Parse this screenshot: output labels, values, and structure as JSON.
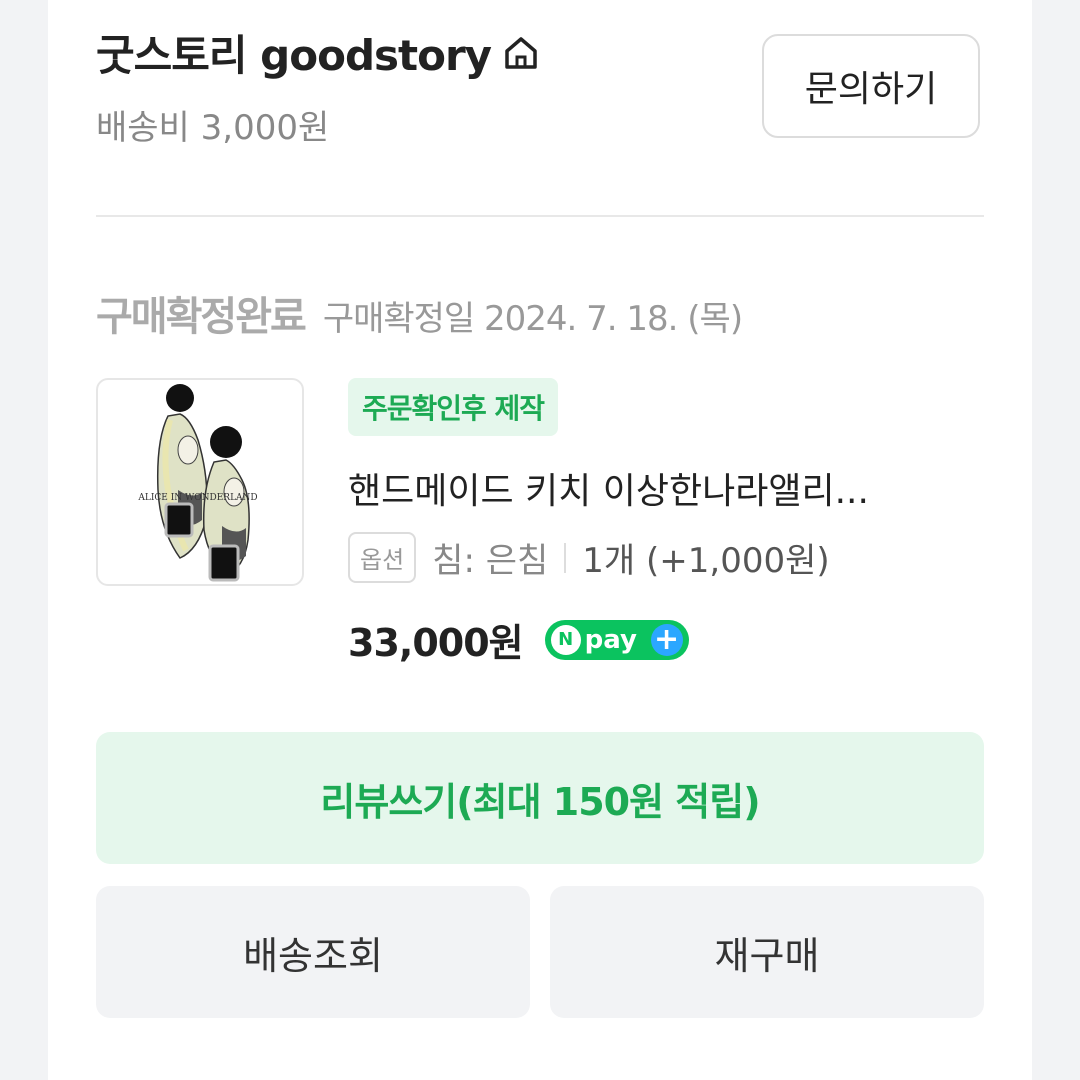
{
  "store": {
    "name": "굿스토리 goodstory",
    "shipping_fee": "배송비 3,000원",
    "inquiry_label": "문의하기"
  },
  "order": {
    "status_label": "구매확정완료",
    "confirm_date": "구매확정일 2024. 7. 18. (목)"
  },
  "product": {
    "badge": "주문확인후 제작",
    "name": "핸드메이드 키치 이상한나라앨리...",
    "option_tag": "옵션",
    "option_value": "침: 은침",
    "quantity": "1개 (+1,000원)",
    "price": "33,000원",
    "npay_label": "pay",
    "npay_n": "N",
    "npay_plus": "+",
    "thumbnail_caption": "ALICE IN WONDERLAND"
  },
  "actions": {
    "review_label": "리뷰쓰기(최대 150원 적립)",
    "delivery_label": "배송조회",
    "rebuy_label": "재구매"
  },
  "colors": {
    "accent_green": "#1daa54",
    "accent_bg": "#e5f7ec",
    "npay_green": "#0bc35f",
    "npay_blue": "#2ba7ff"
  }
}
